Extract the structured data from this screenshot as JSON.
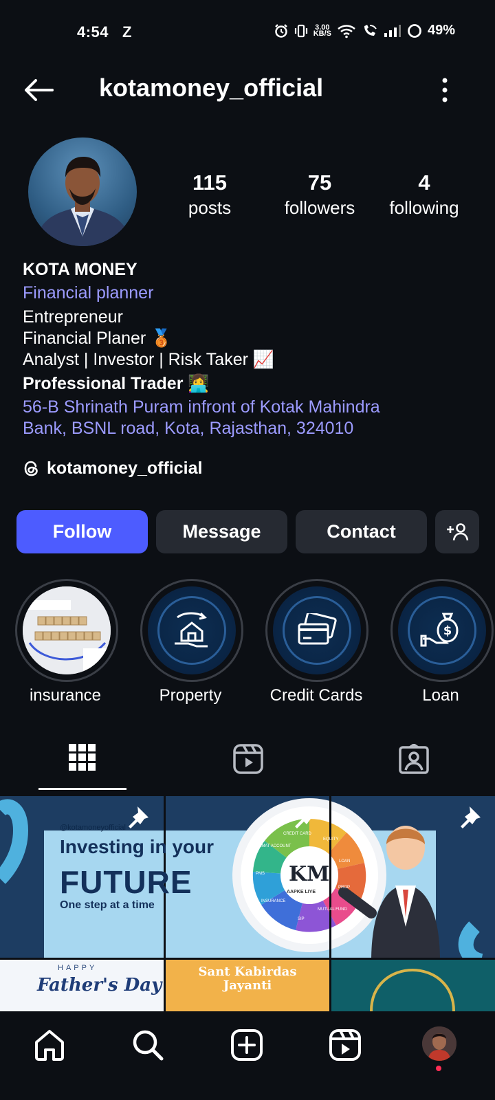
{
  "status_bar": {
    "time": "4:54",
    "carrier_glyph": "Z",
    "net_speed_value": "3.00",
    "net_speed_unit": "KB/S",
    "battery": "49%"
  },
  "header": {
    "username": "kotamoney_official"
  },
  "profile": {
    "posts_count": "115",
    "posts_label": "posts",
    "followers_count": "75",
    "followers_label": "followers",
    "following_count": "4",
    "following_label": "following"
  },
  "bio": {
    "name": "KOTA MONEY",
    "category": "Financial planner",
    "line1": "Entrepreneur",
    "line2": "Financial Planer  🥉",
    "line3": "Analyst | Investor | Risk Taker 📈",
    "line4": "Professional Trader 👩‍💻",
    "address_line1": "56-B Shrinath Puram infront of Kotak Mahindra",
    "address_line2": "Bank, BSNL road, Kota, Rajasthan, 324010",
    "threads_handle": "kotamoney_official"
  },
  "actions": {
    "follow": "Follow",
    "message": "Message",
    "contact": "Contact"
  },
  "highlights": [
    {
      "label": "insurance",
      "icon": "insurance-photo"
    },
    {
      "label": "Property",
      "icon": "house-hand-icon"
    },
    {
      "label": "Credit Cards",
      "icon": "credit-card-icon"
    },
    {
      "label": "Loan",
      "icon": "money-bag-hand-icon"
    }
  ],
  "tabs": [
    {
      "name": "grid",
      "icon": "grid-icon",
      "active": true
    },
    {
      "name": "reels",
      "icon": "reels-icon",
      "active": false
    },
    {
      "name": "tagged",
      "icon": "tagged-icon",
      "active": false
    }
  ],
  "posts": {
    "banner_handle": "@kotamoneyofficial",
    "banner_line1": "Investing in your",
    "banner_line2": "FUTURE",
    "banner_line3": "One step at a time",
    "wheel_logo": "KM",
    "wheel_tagline": "AAPKE LIYE",
    "wheel_segments": [
      "CREDIT CARD",
      "EQUITY",
      "LOAN",
      "PROP",
      "MUTUAL FUND",
      "SIP",
      "INSURANCE",
      "PMS",
      "DEMAT ACCOUNT"
    ],
    "post4_line1": "HAPPY",
    "post4_line2": "Father's Day",
    "post5_title_line1": "Sant Kabirdas",
    "post5_title_line2": "Jayanti"
  },
  "bottom_nav": [
    {
      "name": "home",
      "icon": "home-icon"
    },
    {
      "name": "search",
      "icon": "search-icon"
    },
    {
      "name": "create",
      "icon": "plus-square-icon"
    },
    {
      "name": "reels",
      "icon": "reels-icon"
    },
    {
      "name": "profile",
      "icon": "avatar"
    }
  ],
  "colors": {
    "background": "#0c0f14",
    "follow_button": "#4d5cff",
    "secondary_button": "#262a32",
    "link": "#9c9bff"
  }
}
